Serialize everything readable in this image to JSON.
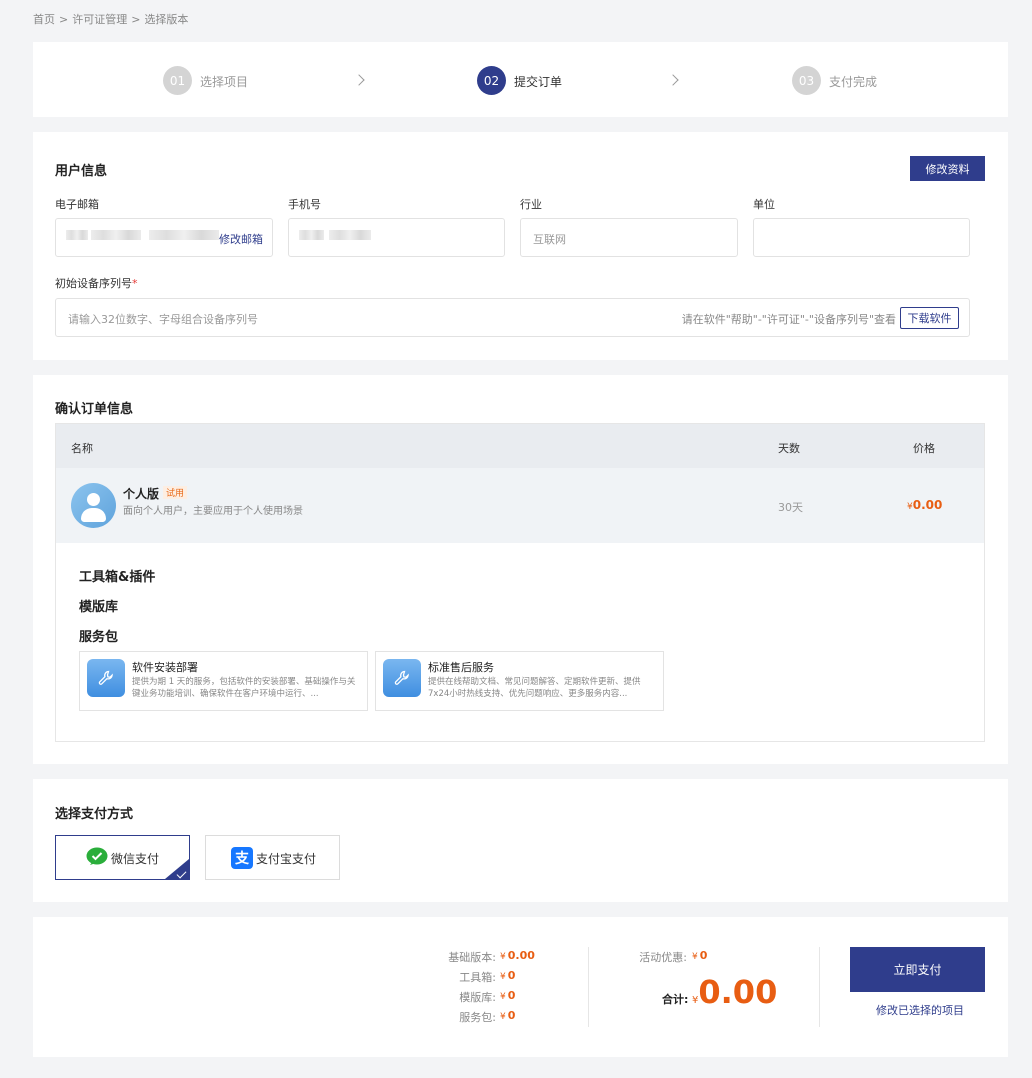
{
  "breadcrumb": {
    "items": [
      "首页",
      ">",
      "许可证管理",
      ">",
      "选择版本"
    ]
  },
  "steps": [
    {
      "num": "01",
      "label": "选择项目",
      "active": false
    },
    {
      "num": "02",
      "label": "提交订单",
      "active": true
    },
    {
      "num": "03",
      "label": "支付完成",
      "active": false
    }
  ],
  "user_info": {
    "title": "用户信息",
    "edit_button": "修改资料",
    "email_label": "电子邮箱",
    "email_change_link": "修改邮箱",
    "phone_label": "手机号",
    "industry_label": "行业",
    "industry_value": "互联网",
    "company_label": "单位",
    "serial_label": "初始设备序列号",
    "required_mark": "*",
    "serial_placeholder": "请输入32位数字、字母组合设备序列号",
    "serial_hint": "请在软件\"帮助\"-\"许可证\"-\"设备序列号\"查看",
    "download_button": "下载软件"
  },
  "order": {
    "title": "确认订单信息",
    "col_name": "名称",
    "col_days": "天数",
    "col_price": "价格",
    "item_name": "个人版",
    "item_badge": "试用",
    "item_desc": "面向个人用户，主要应用于个人使用场景",
    "item_days": "30天",
    "item_price_symbol": "¥",
    "item_price": "0.00",
    "toolbox_title": "工具箱&插件",
    "template_title": "模版库",
    "service_title": "服务包",
    "services": [
      {
        "name": "软件安装部署",
        "desc": "提供为期 1 天的服务，包括软件的安装部署、基础操作与关键业务功能培训、确保软件在客户环境中运行、..."
      },
      {
        "name": "标准售后服务",
        "desc": "提供在线帮助文档、常见问题解答、定期软件更新、提供7x24小时热线支持、优先问题响应、更多服务内容..."
      }
    ]
  },
  "payment": {
    "title": "选择支付方式",
    "wechat": "微信支付",
    "alipay": "支付宝支付",
    "selected": "wechat",
    "wechat_color": "#2aae3b",
    "alipay_color": "#1677ff"
  },
  "summary": {
    "base_label": "基础版本:",
    "base_value": "0.00",
    "toolbox_label": "工具箱:",
    "toolbox_value": "0",
    "template_label": "模版库:",
    "template_value": "0",
    "service_label": "服务包:",
    "service_value": "0",
    "discount_label": "活动优惠:",
    "discount_value": "0",
    "total_label": "合计:",
    "total_value": "0.00",
    "currency": "¥",
    "pay_button": "立即支付",
    "modify_link": "修改已选择的项目"
  },
  "colors": {
    "primary": "#2f3d8c",
    "price": "#e85d12",
    "background": "#f3f4f6"
  }
}
